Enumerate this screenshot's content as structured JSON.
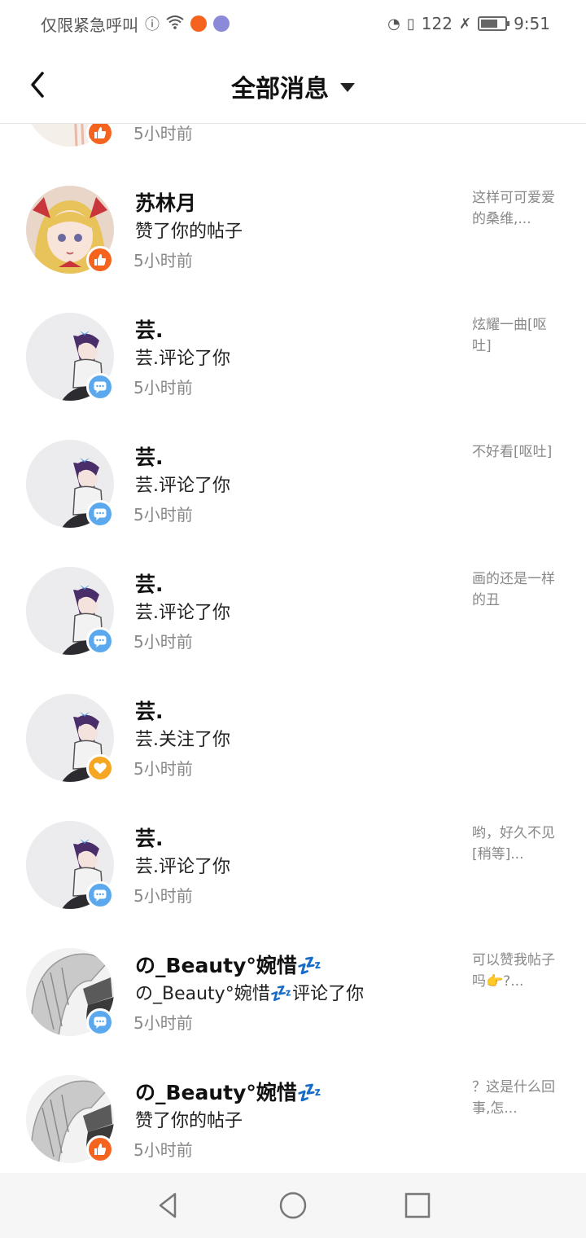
{
  "status_bar": {
    "carrier": "仅限紧急呼叫",
    "speed": "122",
    "time": "9:51",
    "battery_level": 0.7
  },
  "header": {
    "back_icon": "back-arrow-icon",
    "title": "全部消息",
    "dropdown_icon": "caret-down-icon"
  },
  "partial_row": {
    "time": "5小时前",
    "badge": "like"
  },
  "messages": [
    {
      "name": "苏林月",
      "action": "赞了你的帖子",
      "time": "5小时前",
      "badge": "like",
      "preview": "这样可可爱爱的桑维,...",
      "avatar": "blonde"
    },
    {
      "name": "芸.",
      "action": "芸.评论了你",
      "time": "5小时前",
      "badge": "comment",
      "preview": "炫耀一曲[呕吐]",
      "avatar": "purple"
    },
    {
      "name": "芸.",
      "action": "芸.评论了你",
      "time": "5小时前",
      "badge": "comment",
      "preview": "不好看[呕吐]",
      "avatar": "purple"
    },
    {
      "name": "芸.",
      "action": "芸.评论了你",
      "time": "5小时前",
      "badge": "comment",
      "preview": "画的还是一样的丑",
      "avatar": "purple"
    },
    {
      "name": "芸.",
      "action": "芸.关注了你",
      "time": "5小时前",
      "badge": "follow",
      "preview": "",
      "avatar": "purple"
    },
    {
      "name": "芸.",
      "action": "芸.评论了你",
      "time": "5小时前",
      "badge": "comment",
      "preview": "哟，好久不见[稍等]...",
      "avatar": "purple"
    },
    {
      "name": "の_Beauty°婉惜💤",
      "action": "の_Beauty°婉惜💤评论了你",
      "time": "5小时前",
      "badge": "comment",
      "preview": "可以赞我帖子吗👉?...",
      "avatar": "silver"
    },
    {
      "name": "の_Beauty°婉惜💤",
      "action": "赞了你的帖子",
      "time": "5小时前",
      "badge": "like",
      "preview": "？这是什么回事,怎...",
      "avatar": "silver"
    }
  ],
  "system_nav": {
    "back": "triangle-back-icon",
    "home": "circle-home-icon",
    "recents": "square-recents-icon"
  },
  "colors": {
    "like": "#f5641e",
    "comment": "#5aa9ef",
    "follow": "#f5a623"
  }
}
